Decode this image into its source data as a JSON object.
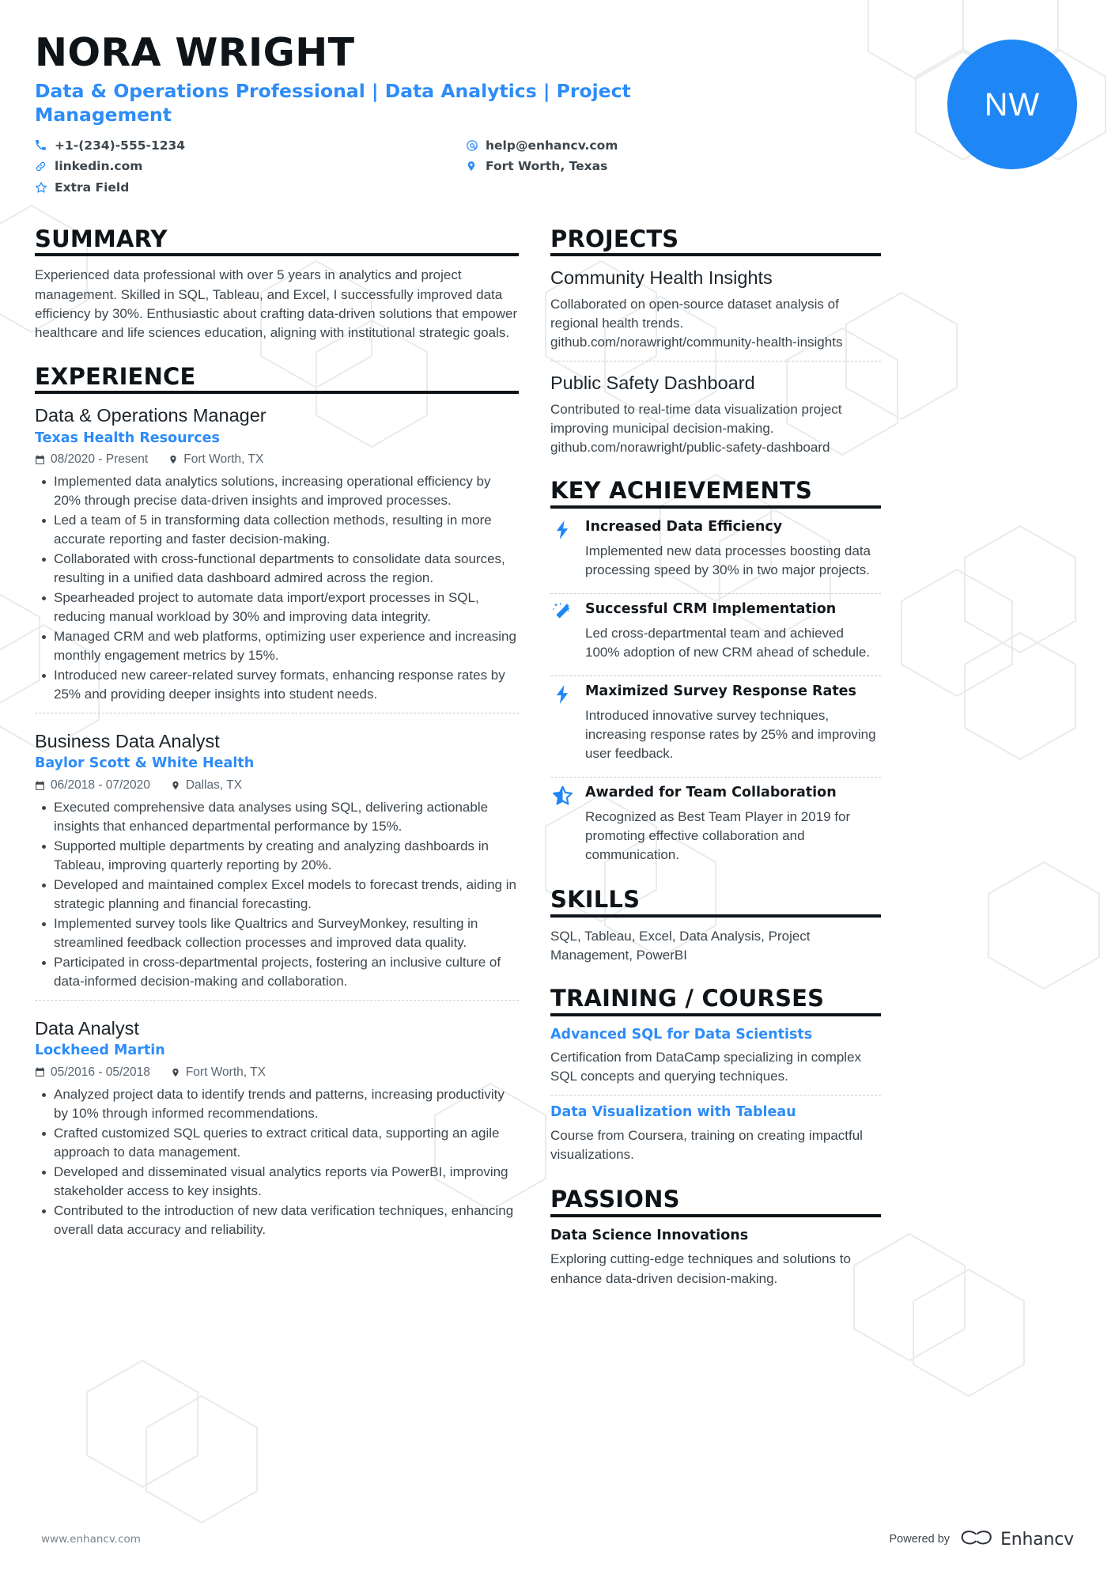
{
  "header": {
    "name": "NORA WRIGHT",
    "headline": "Data & Operations Professional | Data Analytics | Project Management",
    "avatar_initials": "NW",
    "contacts": [
      {
        "icon": "phone-icon",
        "value": "+1-(234)-555-1234"
      },
      {
        "icon": "email-icon",
        "value": "help@enhancv.com"
      },
      {
        "icon": "link-icon",
        "value": "linkedin.com"
      },
      {
        "icon": "location-icon",
        "value": "Fort Worth, Texas"
      },
      {
        "icon": "star-icon",
        "value": "Extra Field"
      }
    ]
  },
  "sections": {
    "summary": {
      "title": "SUMMARY",
      "text": "Experienced data professional with over 5 years in analytics and project management. Skilled in SQL, Tableau, and Excel, I successfully improved data efficiency by 30%. Enthusiastic about crafting data-driven solutions that empower healthcare and life sciences education, aligning with institutional strategic goals."
    },
    "experience": {
      "title": "EXPERIENCE",
      "jobs": [
        {
          "title": "Data & Operations Manager",
          "company": "Texas Health Resources",
          "dates": "08/2020 - Present",
          "location": "Fort Worth, TX",
          "bullets": [
            "Implemented data analytics solutions, increasing operational efficiency by 20% through precise data-driven insights and improved processes.",
            "Led a team of 5 in transforming data collection methods, resulting in more accurate reporting and faster decision-making.",
            "Collaborated with cross-functional departments to consolidate data sources, resulting in a unified data dashboard admired across the region.",
            "Spearheaded project to automate data import/export processes in SQL, reducing manual workload by 30% and improving data integrity.",
            "Managed CRM and web platforms, optimizing user experience and increasing monthly engagement metrics by 15%.",
            "Introduced new career-related survey formats, enhancing response rates by 25% and providing deeper insights into student needs."
          ]
        },
        {
          "title": "Business Data Analyst",
          "company": "Baylor Scott & White Health",
          "dates": "06/2018 - 07/2020",
          "location": "Dallas, TX",
          "bullets": [
            "Executed comprehensive data analyses using SQL, delivering actionable insights that enhanced departmental performance by 15%.",
            "Supported multiple departments by creating and analyzing dashboards in Tableau, improving quarterly reporting by 20%.",
            "Developed and maintained complex Excel models to forecast trends, aiding in strategic planning and financial forecasting.",
            "Implemented survey tools like Qualtrics and SurveyMonkey, resulting in streamlined feedback collection processes and improved data quality.",
            "Participated in cross-departmental projects, fostering an inclusive culture of data-informed decision-making and collaboration."
          ]
        },
        {
          "title": "Data Analyst",
          "company": "Lockheed Martin",
          "dates": "05/2016 - 05/2018",
          "location": "Fort Worth, TX",
          "bullets": [
            "Analyzed project data to identify trends and patterns, increasing productivity by 10% through informed recommendations.",
            "Crafted customized SQL queries to extract critical data, supporting an agile approach to data management.",
            "Developed and disseminated visual analytics reports via PowerBI, improving stakeholder access to key insights.",
            "Contributed to the introduction of new data verification techniques, enhancing overall data accuracy and reliability."
          ]
        }
      ]
    },
    "projects": {
      "title": "PROJECTS",
      "items": [
        {
          "title": "Community Health Insights",
          "description": "Collaborated on open-source dataset analysis of regional health trends. github.com/norawright/community-health-insights"
        },
        {
          "title": "Public Safety Dashboard",
          "description": "Contributed to real-time data visualization project improving municipal decision-making. github.com/norawright/public-safety-dashboard"
        }
      ]
    },
    "key_achievements": {
      "title": "KEY ACHIEVEMENTS",
      "items": [
        {
          "icon": "lightning-bolt-icon",
          "title": "Increased Data Efficiency",
          "description": "Implemented new data processes boosting data processing speed by 30% in two major projects."
        },
        {
          "icon": "magic-wand-icon",
          "title": "Successful CRM Implementation",
          "description": "Led cross-departmental team and achieved 100% adoption of new CRM ahead of schedule."
        },
        {
          "icon": "lightning-bolt-icon",
          "title": "Maximized Survey Response Rates",
          "description": "Introduced innovative survey techniques, increasing response rates by 25% and improving user feedback."
        },
        {
          "icon": "half-star-icon",
          "title": "Awarded for Team Collaboration",
          "description": "Recognized as Best Team Player in 2019 for promoting effective collaboration and communication."
        }
      ]
    },
    "skills": {
      "title": "SKILLS",
      "text": "SQL, Tableau, Excel, Data Analysis, Project Management, PowerBI"
    },
    "training": {
      "title": "TRAINING / COURSES",
      "items": [
        {
          "title": "Advanced SQL for Data Scientists",
          "description": "Certification from DataCamp specializing in complex SQL concepts and querying techniques."
        },
        {
          "title": "Data Visualization with Tableau",
          "description": "Course from Coursera, training on creating impactful visualizations."
        }
      ]
    },
    "passions": {
      "title": "PASSIONS",
      "items": [
        {
          "title": "Data Science Innovations",
          "description": "Exploring cutting-edge techniques and solutions to enhance data-driven decision-making."
        }
      ]
    }
  },
  "footer": {
    "url": "www.enhancv.com",
    "powered_by": "Powered by",
    "brand": "Enhancv"
  },
  "colors": {
    "accent": "#2d8cf8",
    "avatar_bg": "#1f87f5",
    "ink": "#0f1419",
    "body": "#3d464d"
  }
}
